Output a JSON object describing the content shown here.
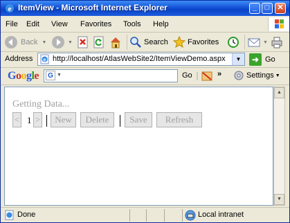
{
  "window": {
    "title": "ItemView - Microsoft Internet Explorer",
    "minimize": "_",
    "maximize": "□",
    "close": "✕"
  },
  "menu": [
    "File",
    "Edit",
    "View",
    "Favorites",
    "Tools",
    "Help"
  ],
  "toolbar": {
    "back_label": "Back",
    "search_label": "Search",
    "favorites_label": "Favorites"
  },
  "address": {
    "label": "Address",
    "url": "http://localhost/AtlasWebSite2/ItemViewDemo.aspx",
    "go_label": "Go"
  },
  "google": {
    "logo": "Google",
    "go_label": "Go",
    "settings_label": "Settings"
  },
  "page": {
    "loading_text": "Getting Data...",
    "prev": "<",
    "page_number": "1",
    "next": ">",
    "new": "New",
    "delete": "Delete",
    "save": "Save",
    "refresh": "Refresh"
  },
  "status": {
    "text": "Done",
    "zone": "Local intranet"
  },
  "icons": [
    "ie-icon",
    "back-arrow-icon",
    "forward-arrow-icon",
    "stop-icon",
    "refresh-icon",
    "home-icon",
    "search-icon",
    "favorites-star-icon",
    "history-icon",
    "mail-icon",
    "print-icon",
    "page-icon",
    "go-arrow-icon",
    "google-icon",
    "settings-gear-icon"
  ],
  "colors": {
    "titlebar": "#1452d7",
    "chrome": "#ece9d8",
    "disabled_text": "#a0a0a0"
  }
}
